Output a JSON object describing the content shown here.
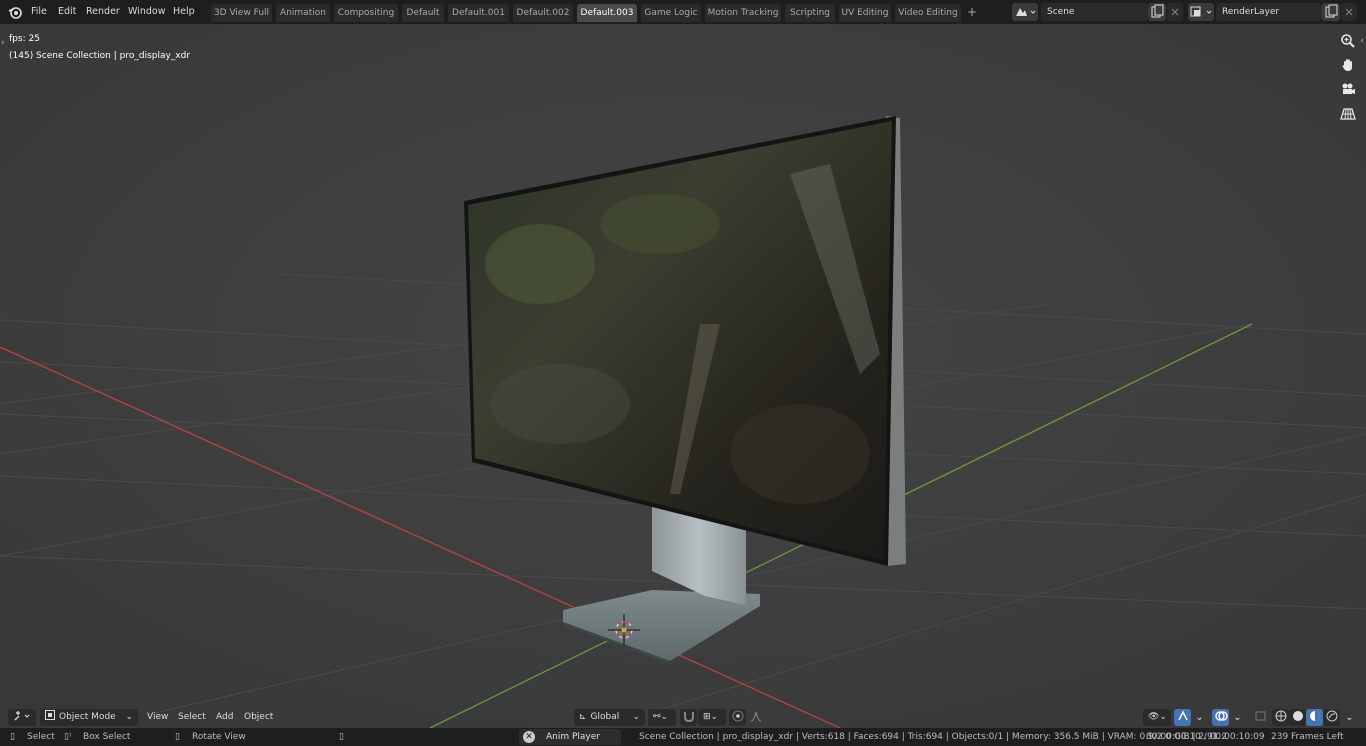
{
  "menu": {
    "file": "File",
    "edit": "Edit",
    "render": "Render",
    "window": "Window",
    "help": "Help"
  },
  "workspaces": [
    {
      "label": "3D View Full",
      "active": false
    },
    {
      "label": "Animation",
      "active": false
    },
    {
      "label": "Compositing",
      "active": false
    },
    {
      "label": "Default",
      "active": false
    },
    {
      "label": "Default.001",
      "active": false
    },
    {
      "label": "Default.002",
      "active": false
    },
    {
      "label": "Default.003",
      "active": true
    },
    {
      "label": "Game Logic",
      "active": false
    },
    {
      "label": "Motion Tracking",
      "active": false
    },
    {
      "label": "Scripting",
      "active": false
    },
    {
      "label": "UV Editing",
      "active": false
    },
    {
      "label": "Video Editing",
      "active": false
    }
  ],
  "add_workspace": "+",
  "scene": {
    "value": "Scene"
  },
  "view_layer": {
    "value": "RenderLayer"
  },
  "viewport": {
    "fps": "fps: 25",
    "collection": "(145) Scene Collection | pro_display_xdr"
  },
  "header": {
    "mode": "Object Mode",
    "view": "View",
    "select": "Select",
    "add": "Add",
    "object": "Object",
    "orientation": "Global"
  },
  "status": {
    "select": "Select",
    "box_select": "Box Select",
    "rotate_view": "Rotate View",
    "anim_player": "Anim Player",
    "stats": "Scene Collection | pro_display_xdr | Verts:618 | Faces:694 | Tris:694 | Objects:0/1 | Memory: 356.5 MiB | VRAM: 0.9/2.0 GiB | 2.91.2",
    "time": "00:00:00:10 / 00:00:10:09",
    "frames_left": "239 Frames Left"
  },
  "colors": {
    "x_axis": "#b64444",
    "y_axis": "#6e9a3a",
    "active_tab": "#4a4a4a",
    "accent_blue": "#4772b3"
  }
}
